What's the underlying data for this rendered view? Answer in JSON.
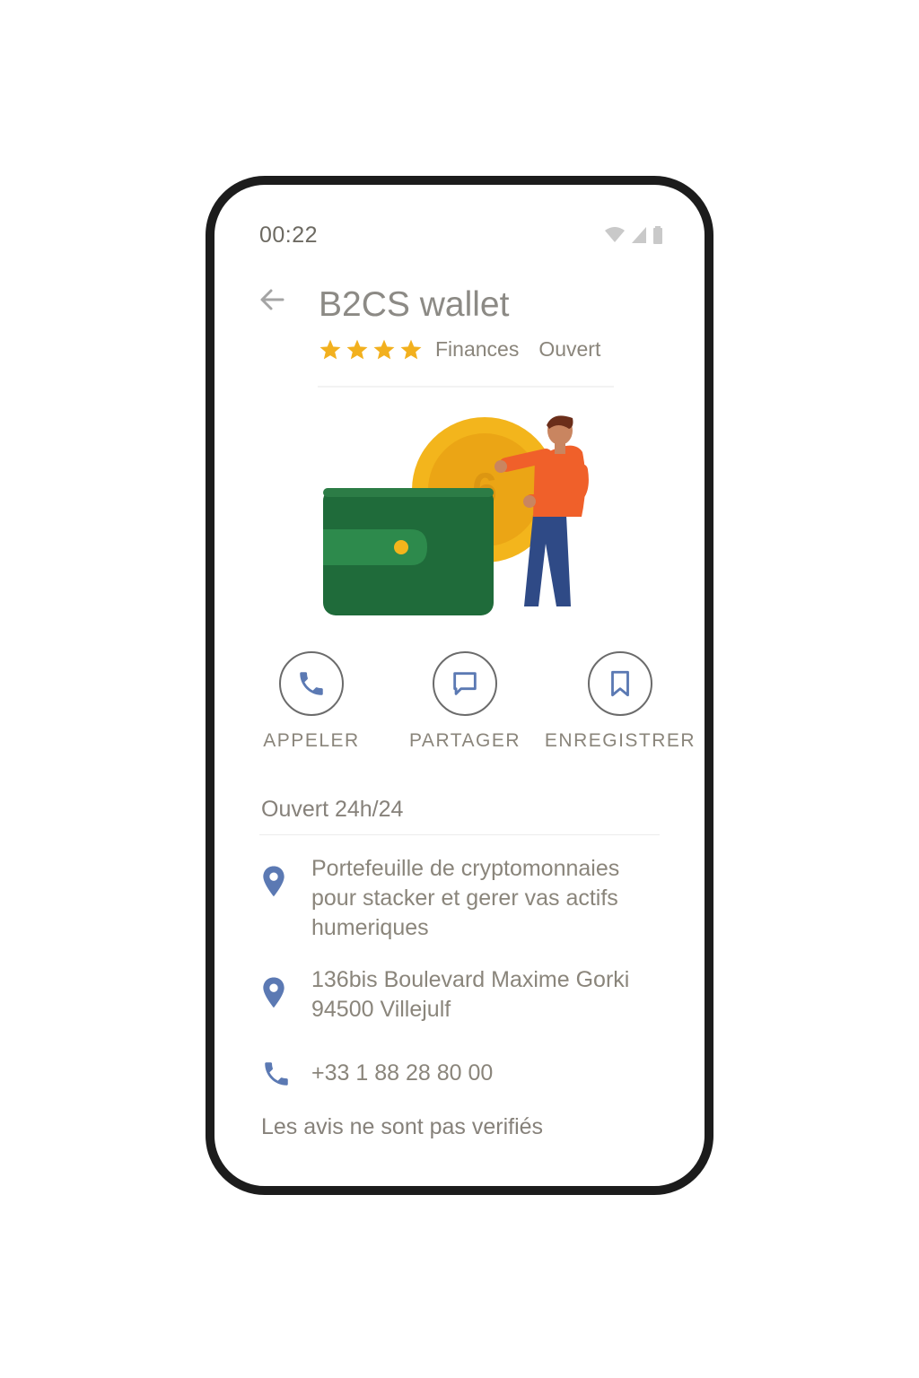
{
  "status_bar": {
    "time": "00:22"
  },
  "place": {
    "name": "B2CS wallet",
    "rating_stars": 4,
    "category": "Finances",
    "open_status": "Ouvert"
  },
  "actions": {
    "call_label": "APPELER",
    "share_label": "PARTAGER",
    "save_label": "ENREGISTRER"
  },
  "hours": "Ouvert 24h/24",
  "description": {
    "line1": "Portefeuille de cryptomonnaies",
    "line2": "pour stacker et gerer vas actifs",
    "line3": "humeriques"
  },
  "address": {
    "line1": "136bis Boulevard Maxime Gorki",
    "line2": "94500 Villejulf"
  },
  "phone": "+33 1 88 28 80 00",
  "reviews_note": "Les avis ne sont pas verifiés",
  "colors": {
    "star": "#f2b01e",
    "icon_blue": "#5b79b3",
    "wallet_green": "#1f6b3a",
    "coin_gold": "#f3b51c",
    "shirt_orange": "#f0602a"
  }
}
